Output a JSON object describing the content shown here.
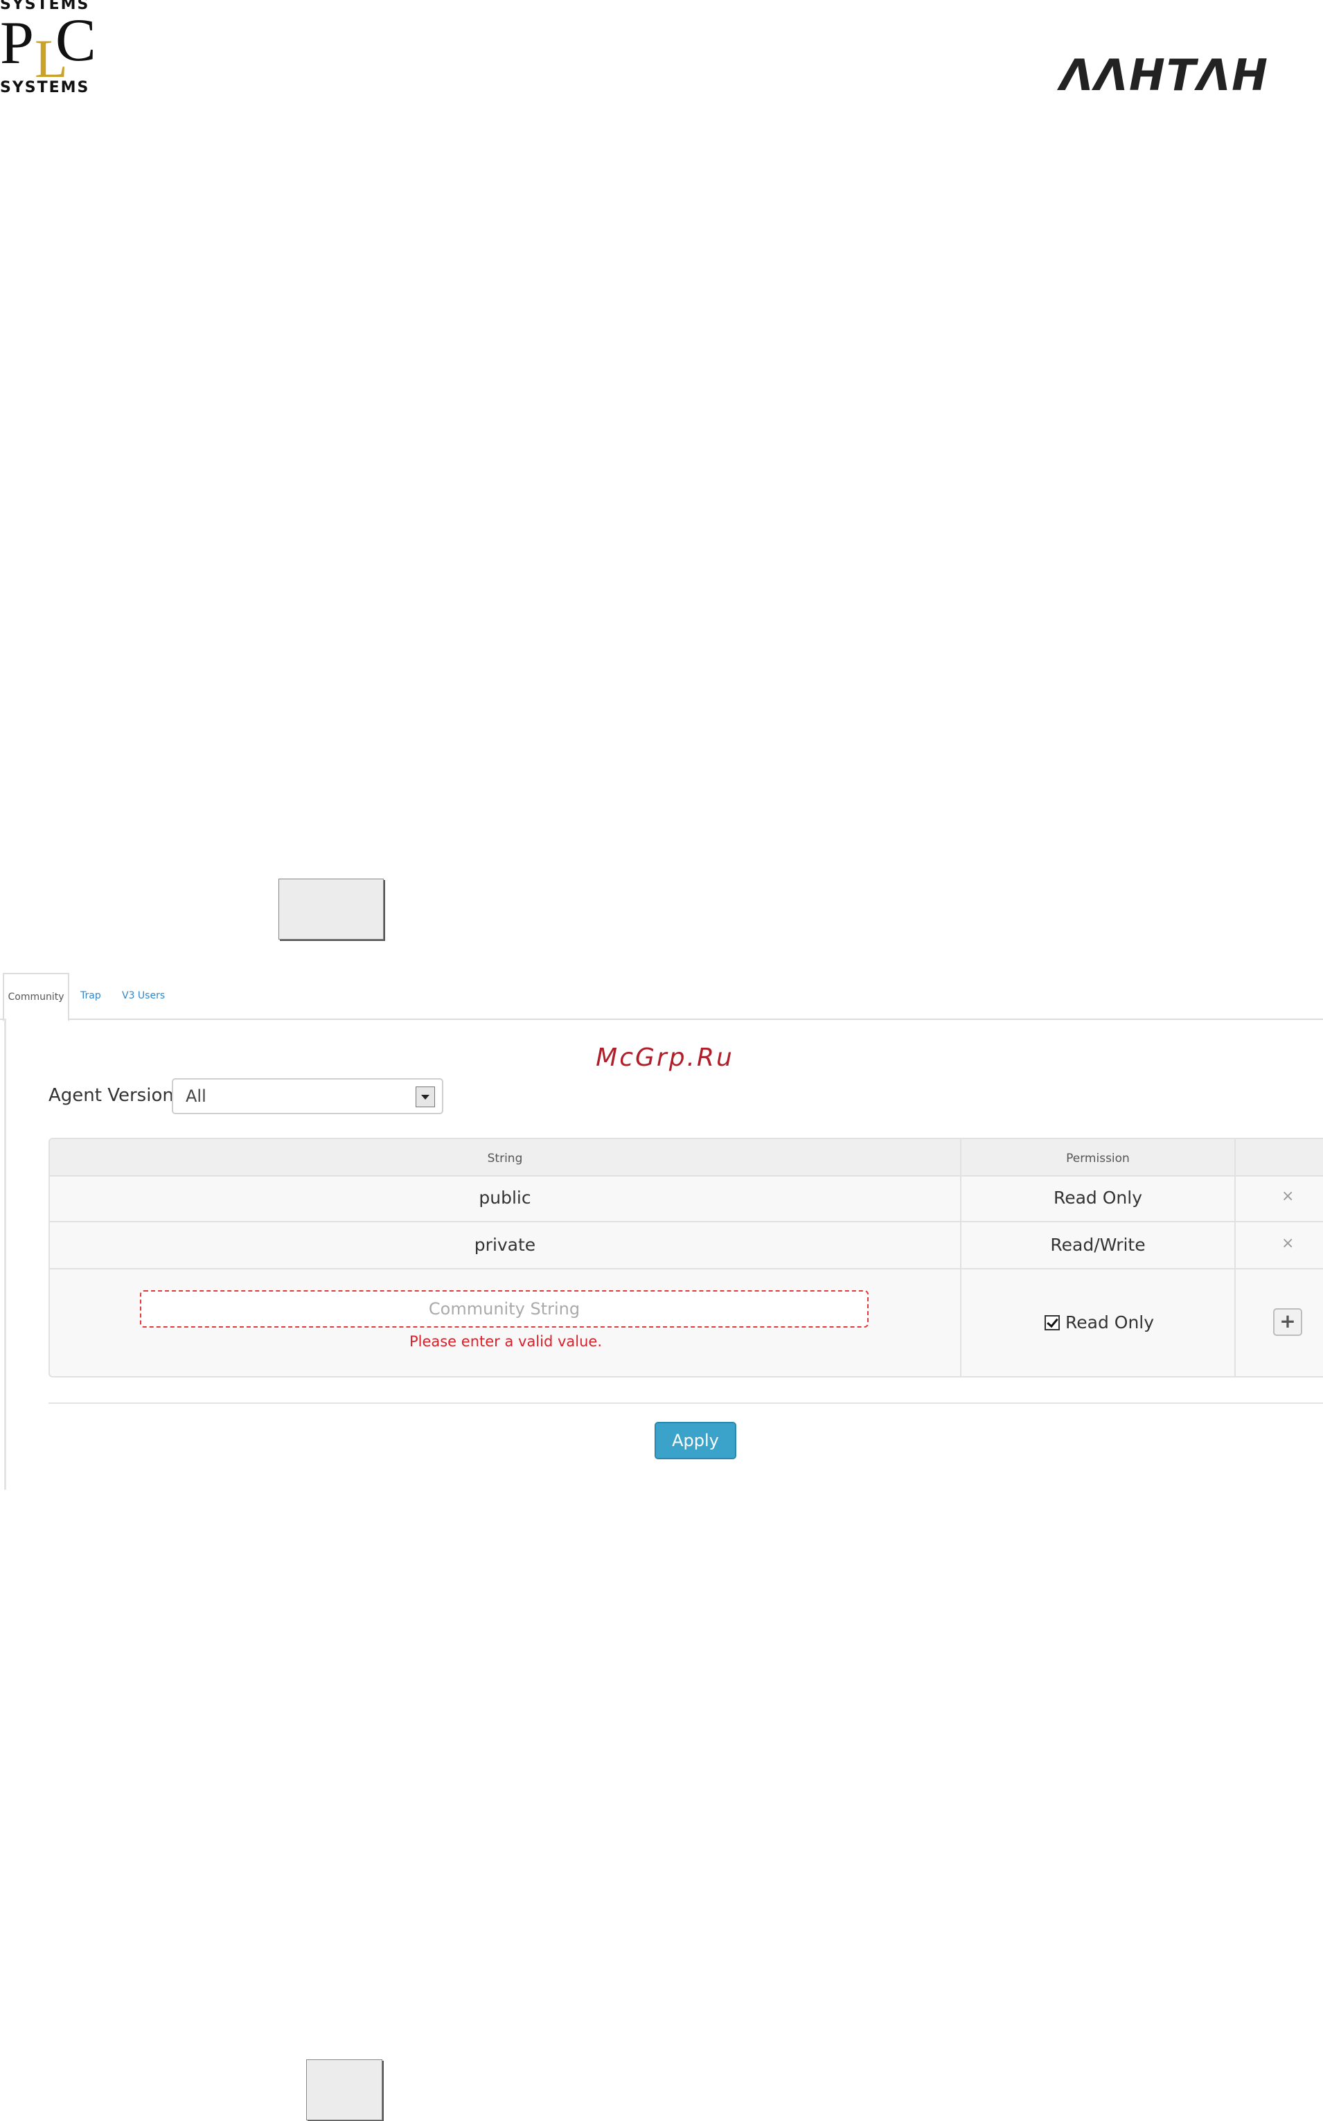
{
  "plc_logo": {
    "systems_top": "SYSTEMS",
    "p": "P",
    "l": "L",
    "c": "C",
    "systems_bottom": "SYSTEMS"
  },
  "lantan_logo": "ΛΛΗΤΛΗ",
  "tabs": [
    {
      "label": "Community",
      "active": true
    },
    {
      "label": "Trap",
      "active": false
    },
    {
      "label": "V3 Users",
      "active": false
    }
  ],
  "watermark": "McGrp.Ru",
  "agent_version": {
    "label": "Agent Version",
    "value": "All"
  },
  "table": {
    "headers": [
      "String",
      "Permission",
      ""
    ],
    "rows": [
      {
        "string": "public",
        "permission": "Read Only",
        "delete": "×"
      },
      {
        "string": "private",
        "permission": "Read/Write",
        "delete": "×"
      }
    ],
    "new_row": {
      "placeholder": "Community String",
      "error": "Please enter a valid value.",
      "checkbox_label": "Read Only",
      "checkbox_checked": true,
      "add_label": "+"
    }
  },
  "apply_label": "Apply",
  "colors": {
    "accent": "#3ba3c9",
    "error": "#d8212a",
    "link": "#2f86c9",
    "watermark": "#b01e2a"
  }
}
